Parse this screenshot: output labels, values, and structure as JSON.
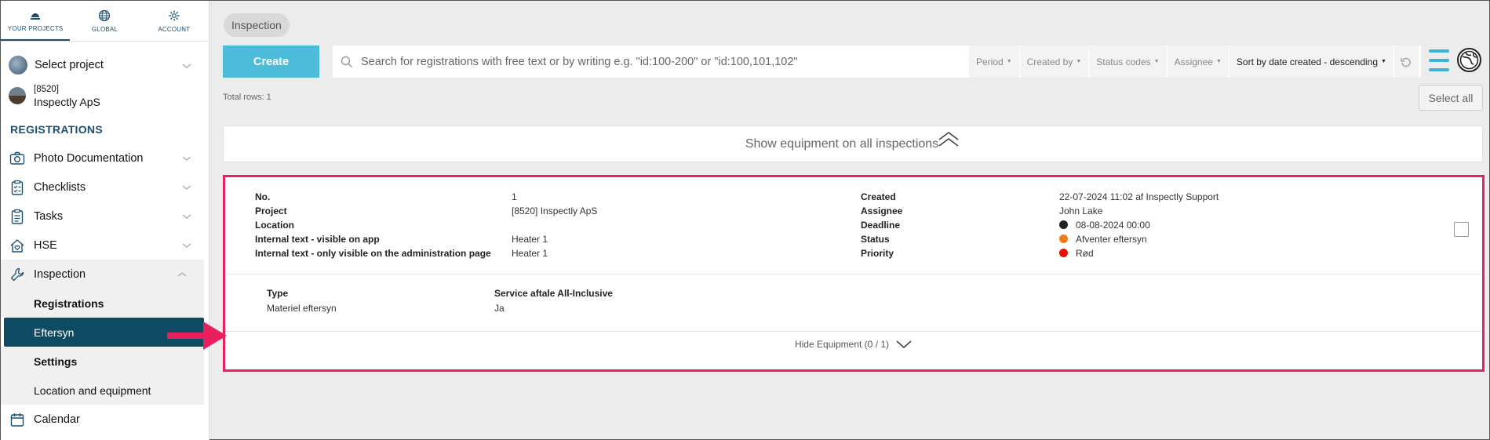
{
  "topnav": [
    {
      "label": "YOUR PROJECTS",
      "icon": "hardhat-icon"
    },
    {
      "label": "GLOBAL",
      "icon": "globe-icon"
    },
    {
      "label": "ACCOUNT",
      "icon": "gear-icon"
    }
  ],
  "select_project": {
    "label": "Select project"
  },
  "project": {
    "id": "[8520]",
    "name": "Inspectly ApS"
  },
  "registrations_heading": "REGISTRATIONS",
  "menu": {
    "photo": "Photo Documentation",
    "checklists": "Checklists",
    "tasks": "Tasks",
    "hse": "HSE",
    "inspection": "Inspection",
    "sub": {
      "registrations": "Registrations",
      "eftersyn": "Eftersyn",
      "settings": "Settings",
      "location": "Location and equipment"
    },
    "calendar": "Calendar"
  },
  "breadcrumb": "Inspection",
  "toolbar": {
    "create": "Create",
    "search_placeholder": "Search for registrations with free text or by writing e.g. \"id:100-200\" or \"id:100,101,102\"",
    "period": "Period",
    "created_by": "Created by",
    "status_codes": "Status codes",
    "assignee": "Assignee",
    "sort": "Sort by date created - descending"
  },
  "total_rows": "Total rows: 1",
  "select_all": "Select all",
  "show_equipment": "Show equipment on all inspections",
  "inspection": {
    "labels": {
      "no": "No.",
      "project": "Project",
      "location": "Location",
      "internal_app": "Internal text - visible on app",
      "internal_admin": "Internal text - only visible on the administration page",
      "created": "Created",
      "assignee": "Assignee",
      "deadline": "Deadline",
      "status": "Status",
      "priority": "Priority"
    },
    "values": {
      "no": "1",
      "project": "[8520] Inspectly ApS",
      "location": "",
      "internal_app": "Heater 1",
      "internal_admin": "Heater 1",
      "created": "22-07-2024 11:02 af Inspectly Support",
      "assignee": "John Lake",
      "deadline": "08-08-2024 00:00",
      "status": "Afventer eftersyn",
      "priority": "Rød"
    },
    "colors": {
      "deadline": "#222222",
      "status": "#f07d14",
      "priority": "#e3120b"
    },
    "equipment": {
      "type_header": "Type",
      "type_value": "Materiel eftersyn",
      "service_header": "Service aftale All-Inclusive",
      "service_value": "Ja"
    },
    "hide_equipment": "Hide Equipment (0 / 1)"
  },
  "colors": {
    "accent": "#4cbcd9",
    "nav_dark": "#0e4a61",
    "highlight": "#ea1f5e"
  }
}
